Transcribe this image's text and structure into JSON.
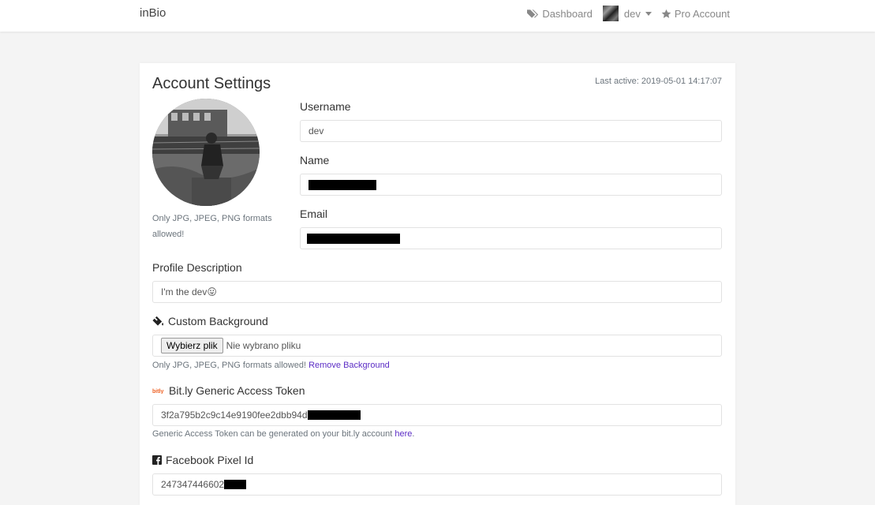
{
  "navbar": {
    "brand": "inBio",
    "dashboard": "Dashboard",
    "user": "dev",
    "pro": "Pro Account"
  },
  "settings": {
    "title": "Account Settings",
    "last_active": "Last active: 2019-05-01 14:17:07",
    "avatar_note": "Only JPG, JPEG, PNG formats allowed!",
    "username_label": "Username",
    "username_value": "dev",
    "name_label": "Name",
    "email_label": "Email",
    "profile_label": "Profile Description",
    "profile_value": "I'm the dev😛",
    "bg_label": "Custom Background",
    "file_button": "Wybierz plik",
    "file_none": "Nie wybrano pliku",
    "bg_note": "Only JPG, JPEG, PNG formats allowed!",
    "remove_bg": "Remove Background",
    "bitly_label": "Bit.ly Generic Access Token",
    "bitly_value": "3f2a795b2c9c14e9190fee2dbb94d",
    "bitly_note": "Generic Access Token can be generated on your bit.ly account",
    "bitly_link": "here",
    "bitly_note_end": ".",
    "fb_label": "Facebook Pixel Id",
    "fb_value": "247347446602"
  },
  "colors": {
    "link": "#5b2cc5",
    "bitly": "#ee6123"
  },
  "icons": [
    "tags-icon",
    "star-icon",
    "paint-bucket-icon",
    "bitly-logo-icon",
    "facebook-icon"
  ]
}
